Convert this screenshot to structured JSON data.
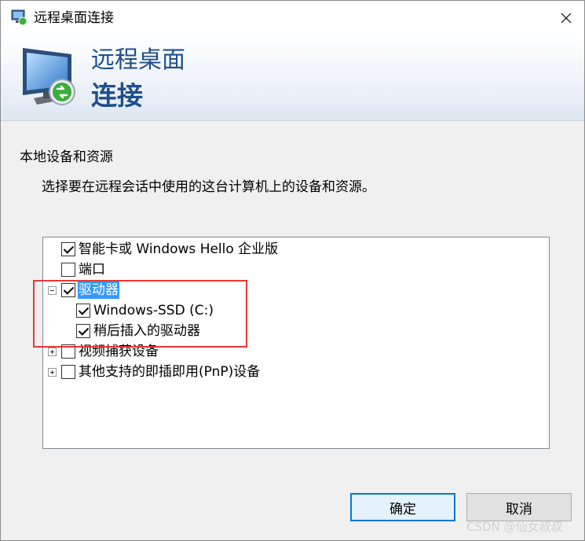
{
  "window": {
    "title": "远程桌面连接"
  },
  "banner": {
    "line1": "远程桌面",
    "line2": "连接"
  },
  "group": {
    "title": "本地设备和资源",
    "description": "选择要在远程会话中使用的这台计算机上的设备和资源。"
  },
  "devices": [
    {
      "label": "智能卡或 Windows Hello 企业版",
      "checked": true,
      "expander": "none"
    },
    {
      "label": "端口",
      "checked": false,
      "expander": "none"
    },
    {
      "label": "驱动器",
      "checked": true,
      "expander": "expanded",
      "selected": true,
      "children": [
        {
          "label": "Windows-SSD (C:)",
          "checked": true
        },
        {
          "label": "稍后插入的驱动器",
          "checked": true
        }
      ]
    },
    {
      "label": "视频捕获设备",
      "checked": false,
      "expander": "collapsed"
    },
    {
      "label": "其他支持的即插即用(PnP)设备",
      "checked": false,
      "expander": "collapsed"
    }
  ],
  "buttons": {
    "ok": "确定",
    "cancel": "取消"
  },
  "watermark": "CSDN @仙女叔叔",
  "colors": {
    "banner_text": "#1f4f8a",
    "highlight_box": "#e53935",
    "selection": "#3399ff",
    "primary_border": "#0078d7"
  }
}
